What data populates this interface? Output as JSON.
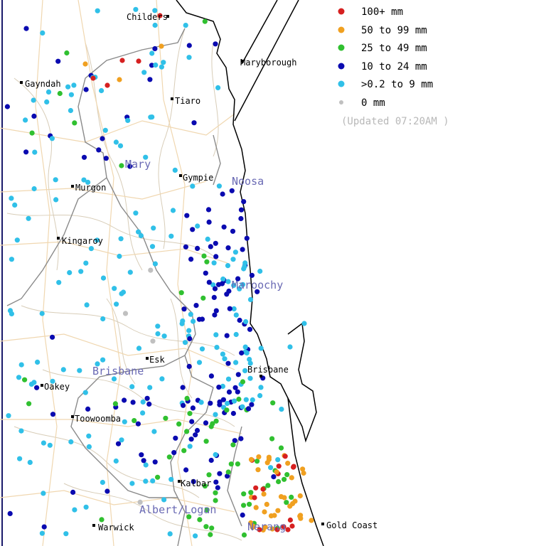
{
  "legend": {
    "items": [
      {
        "label": "100+ mm",
        "color": "#d62020"
      },
      {
        "label": "50  to 99 mm",
        "color": "#f0a020"
      },
      {
        "label": "25  to 49 mm",
        "color": "#30c030"
      },
      {
        "label": "10  to 24 mm",
        "color": "#0a0ab0"
      },
      {
        "label": ">0.2 to 9 mm",
        "color": "#30c0e8"
      },
      {
        "label": "0 mm",
        "color": "#c0c0c0"
      }
    ],
    "updated": "(Updated 07:20AM  )"
  },
  "towns": [
    "Childers",
    "Maryborough",
    "Gayndah",
    "Tiaro",
    "Gympie",
    "Murgon",
    "Kingaroy",
    "Esk",
    "Brisbane",
    "Oakey",
    "Toowoomba",
    "Kalbar",
    "Warwick",
    "Gold Coast",
    "Nerang"
  ],
  "basins": [
    "Mary",
    "Noosa",
    "Maroochy",
    "Brisbane",
    "Albert/Logan"
  ]
}
